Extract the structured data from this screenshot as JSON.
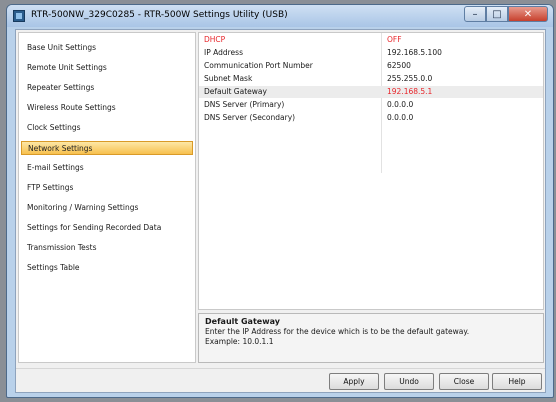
{
  "window": {
    "title": "RTR-500NW_329C0285 - RTR-500W Settings Utility (USB)",
    "controls": {
      "minimize": "–",
      "maximize": "□",
      "close": "✕"
    }
  },
  "sidebar": {
    "items": [
      {
        "label": "Base Unit Settings",
        "selected": false
      },
      {
        "label": "Remote Unit Settings",
        "selected": false
      },
      {
        "label": "Repeater Settings",
        "selected": false
      },
      {
        "label": "Wireless Route Settings",
        "selected": false
      },
      {
        "label": "Clock Settings",
        "selected": false
      },
      {
        "label": "Network Settings",
        "selected": true
      },
      {
        "label": "E-mail Settings",
        "selected": false
      },
      {
        "label": "FTP Settings",
        "selected": false
      },
      {
        "label": "Monitoring / Warning Settings",
        "selected": false
      },
      {
        "label": "Settings for Sending Recorded Data",
        "selected": false
      },
      {
        "label": "Transmission Tests",
        "selected": false
      },
      {
        "label": "Settings Table",
        "selected": false
      }
    ]
  },
  "settings": {
    "rows": [
      {
        "label": "DHCP",
        "value": "OFF"
      },
      {
        "label": "IP Address",
        "value": "192.168.5.100"
      },
      {
        "label": "Communication Port Number",
        "value": "62500"
      },
      {
        "label": "Subnet Mask",
        "value": "255.255.0.0"
      },
      {
        "label": "Default Gateway",
        "value": "192.168.5.1"
      },
      {
        "label": "DNS Server (Primary)",
        "value": "0.0.0.0"
      },
      {
        "label": "DNS Server (Secondary)",
        "value": "0.0.0.0"
      }
    ]
  },
  "help": {
    "title": "Default Gateway",
    "line1": "Enter the IP Address for the device which is to be the default gateway.",
    "line2": "Example: 10.0.1.1"
  },
  "buttons": {
    "apply": "Apply",
    "undo": "Undo",
    "close": "Close",
    "help": "Help"
  },
  "colors": {
    "accent_red": "#e8262b",
    "selected_bg": "#f7c04e",
    "titlebar": "#a9c5e6"
  }
}
